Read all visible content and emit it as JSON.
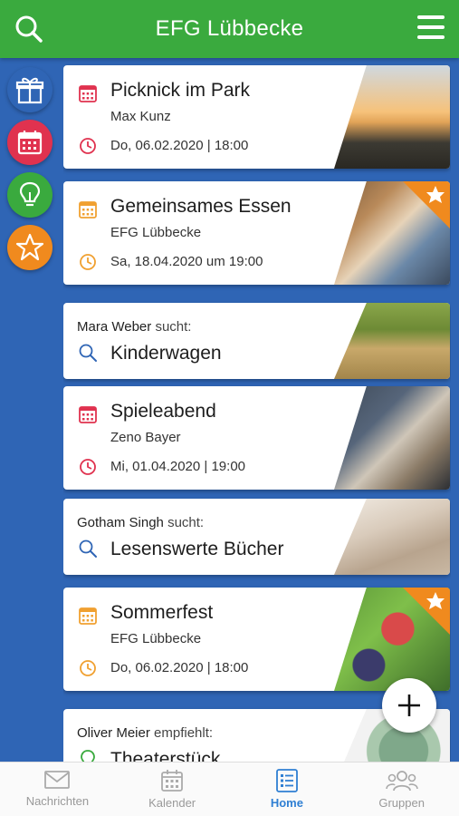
{
  "header": {
    "title": "EFG Lübbecke"
  },
  "side_buttons": [
    {
      "icon": "gift-icon",
      "color": "#2f65b5"
    },
    {
      "icon": "calendar-icon",
      "color": "#e0324f"
    },
    {
      "icon": "lightbulb-icon",
      "color": "#3aaa3e"
    },
    {
      "icon": "star-icon",
      "color": "#f08a1e"
    }
  ],
  "cards": [
    {
      "type": "event",
      "title": "Picknick im Park",
      "subtitle": "Max Kunz",
      "date": "Do, 06.02.2020 | 18:00",
      "accent": "#e0324f",
      "starred": false
    },
    {
      "type": "event",
      "title": "Gemeinsames Essen",
      "subtitle": "EFG Lübbecke",
      "date": "Sa, 18.04.2020 um 19:00",
      "accent": "#f0a030",
      "starred": true
    },
    {
      "type": "search",
      "name": "Mara Weber",
      "verb": "sucht:",
      "item": "Kinderwagen"
    },
    {
      "type": "event",
      "title": "Spieleabend",
      "subtitle": "Zeno Bayer",
      "date": "Mi, 01.04.2020 | 19:00",
      "accent": "#e0324f",
      "starred": false
    },
    {
      "type": "search",
      "name": "Gotham Singh",
      "verb": "sucht:",
      "item": "Lesenswerte Bücher"
    },
    {
      "type": "event",
      "title": "Sommerfest",
      "subtitle": "EFG Lübbecke",
      "date": "Do, 06.02.2020 | 18:00",
      "accent": "#f0a030",
      "starred": true
    },
    {
      "type": "recommend",
      "name": "Oliver Meier",
      "verb": "empfiehlt:",
      "item": "Theaterstück"
    }
  ],
  "nav": [
    {
      "label": "Nachrichten",
      "icon": "mail-icon",
      "active": false
    },
    {
      "label": "Kalender",
      "icon": "calendar-icon",
      "active": false
    },
    {
      "label": "Home",
      "icon": "home-list-icon",
      "active": true
    },
    {
      "label": "Gruppen",
      "icon": "group-icon",
      "active": false
    }
  ]
}
